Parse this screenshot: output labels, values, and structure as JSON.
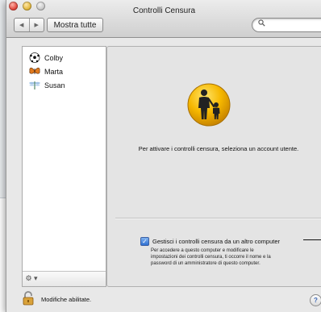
{
  "window": {
    "title": "Controlli Censura",
    "nav_back": "◀",
    "nav_forward": "▶",
    "show_all": "Mostra tutte",
    "search_placeholder": ""
  },
  "sidebar": {
    "users": [
      {
        "name": "Colby",
        "icon": "soccer-ball-icon"
      },
      {
        "name": "Marta",
        "icon": "butterfly-icon"
      },
      {
        "name": "Susan",
        "icon": "dragonfly-icon"
      }
    ],
    "action_button": "⚙ ▾"
  },
  "panel": {
    "icon": "parental-controls-icon",
    "message": "Per attivare i controlli censura, seleziona un account utente.",
    "remote_checkbox": {
      "label": "Gestisci i controlli censura da un altro computer",
      "checked": true,
      "description": "Per accedere a questo computer e modificare le impostazioni dei controlli censura, ti occorre il nome e la password di un amministratore di questo computer."
    }
  },
  "footer": {
    "lock_label": "Modifiche abilitate.",
    "help": "?"
  },
  "colors": {
    "accent": "#2f6fd1",
    "icon_yellow": "#f2b400"
  }
}
